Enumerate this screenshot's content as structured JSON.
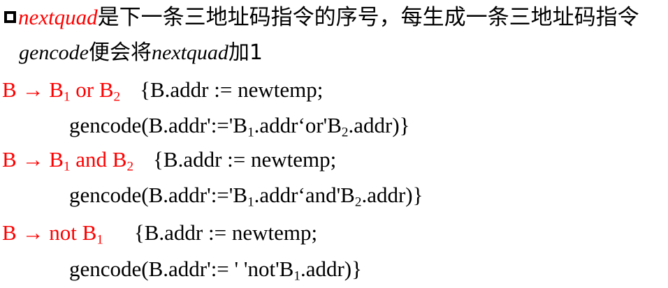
{
  "intro": {
    "var1": "nextquad",
    "text1": "是下一条三地址码指令的序号，每生成一条三地址码指令",
    "gencode": "gencode",
    "text2": "便会将",
    "var2": "nextquad",
    "text3": "加1"
  },
  "rules": [
    {
      "lhs": "B",
      "arrow": "→",
      "b1": "B",
      "sub1": "1",
      "op": "or",
      "b2": "B",
      "sub2": "2",
      "action": "{B.addr := newtemp;",
      "code_a": "gencode(B.addr':='B",
      "code_sub1": "1",
      "code_b": ".addr‘or'B",
      "code_sub2": "2",
      "code_c": ".addr)}"
    },
    {
      "lhs": "B",
      "arrow": "→",
      "b1": "B",
      "sub1": "1",
      "op": "and",
      "b2": "B",
      "sub2": "2",
      "action": "{B.addr := newtemp;",
      "code_a": "gencode(B.addr':='B",
      "code_sub1": "1",
      "code_b": ".addr‘and'B",
      "code_sub2": "2",
      "code_c": ".addr)}"
    },
    {
      "lhs": "B",
      "arrow": "→",
      "op": "not",
      "b1": "B",
      "sub1": "1",
      "action": "{B.addr := newtemp;",
      "code_a": "gencode(B.addr':= ' 'not'B",
      "code_sub1": "1",
      "code_b": ".addr)}"
    }
  ]
}
